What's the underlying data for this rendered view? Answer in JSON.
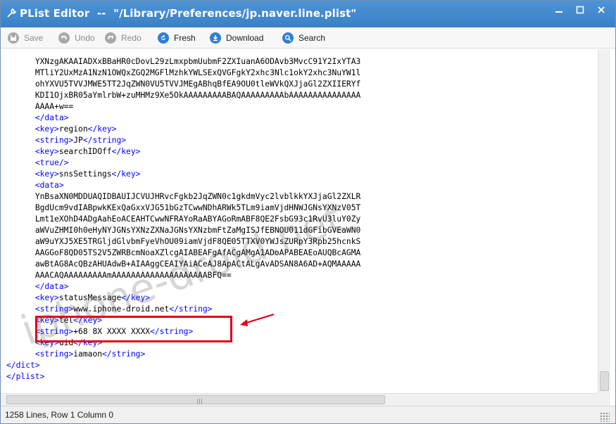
{
  "window": {
    "title": "PList Editor  --  \"/Library/Preferences/jp.naver.line.plist\"",
    "icons": {
      "app": "wrench-icon",
      "minimize": "minimize-icon",
      "maximize": "maximize-icon",
      "close": "close-icon"
    }
  },
  "toolbar": {
    "save": {
      "label": "Save",
      "icon": "save-icon"
    },
    "undo": {
      "label": "Undo",
      "icon": "undo-icon"
    },
    "redo": {
      "label": "Redo",
      "icon": "redo-icon"
    },
    "refresh": {
      "label": "Fresh",
      "icon": "refresh-icon"
    },
    "download": {
      "label": "Download",
      "icon": "download-icon"
    },
    "search": {
      "label": "Search",
      "icon": "search-icon"
    }
  },
  "editor": {
    "lines": [
      {
        "indent": "      ",
        "text": "YXNzgAKAAIADXxBBaHR0cDovL29zLmxpbmUubmF2ZXIuanA6ODAvb3MvcC91Y2IxYTA3"
      },
      {
        "indent": "      ",
        "text": "MTliY2UxMzA1NzN1OWQxZGQ2MGFlMzhkYWLSExQVGFgkY2xhc3Nlc1okY2xhc3NuYW1l"
      },
      {
        "indent": "      ",
        "text": "ohYXVU5TVVJMWE5TT2JqZWN0VU5TVVJMEgABhqBfEA9OU0tleWVkQXJjaGl2ZXIIERYf"
      },
      {
        "indent": "      ",
        "text": "KDI1OjxBR05aYmlrbW+zuMHMz9Xe5OkAAAAAAAAABAQAAAAAAAAAbAAAAAAAAAAAAAAA"
      },
      {
        "indent": "      ",
        "text": "AAAA+w=="
      },
      {
        "indent": "      ",
        "tag_open": "</data>",
        "value": "",
        "tag_close": ""
      },
      {
        "indent": "      ",
        "tag_open": "<key>",
        "value": "region",
        "tag_close": "</key>"
      },
      {
        "indent": "      ",
        "tag_open": "<string>",
        "value": "JP",
        "tag_close": "</string>"
      },
      {
        "indent": "      ",
        "tag_open": "<key>",
        "value": "searchIDOff",
        "tag_close": "</key>"
      },
      {
        "indent": "      ",
        "tag_open": "<true/>",
        "value": "",
        "tag_close": ""
      },
      {
        "indent": "      ",
        "tag_open": "<key>",
        "value": "snsSettings",
        "tag_close": "</key>"
      },
      {
        "indent": "      ",
        "tag_open": "<data>",
        "value": "",
        "tag_close": ""
      },
      {
        "indent": "      ",
        "text": "YnBsaXN0MDDUAQIDBAUIJCVUJHRvcFgkb2JqZWN0c1gkdmVyc2lvblkkYXJjaGl2ZXLR"
      },
      {
        "indent": "      ",
        "text": "BgdUcm9vdIABpwkKExQaGxxVJG51bGzTCwwNDhARWk5TLm9iamVjdHNWJGNsYXNzV05T"
      },
      {
        "indent": "      ",
        "text": "Lmt1eXOhD4ADgAahEoACEAHTCwwNFRAYoRaABYAGoRmABF8QE2FsbG93c1RvU3luY0Zy"
      },
      {
        "indent": "      ",
        "text": "aWVuZHMI0h0eHyNYJGNsYXNzZXNaJGNsYXNzbmFtZaMgISJfEBNOU011dGFibGVEaWN0"
      },
      {
        "indent": "      ",
        "text": "aW9uYXJ5XE5TRGljdGlvbmFyeVhOU09iamVjdF8QE05TTXV0YWJsZURpY3Rpb25hcnkS"
      },
      {
        "indent": "      ",
        "text": "AAGGoF8QD05TS2V5ZWRBcmNoaXZlcgAIABEAFgAfACgAMgA1ADoAPABEAEoAUQBcAGMA"
      },
      {
        "indent": "      ",
        "text": "awBtAG8AcQBzAHUAdwB+AIAAggCEAIYAiACeAJ8ApACtALgAvADSAN8A6AD+AQMAAAAA"
      },
      {
        "indent": "      ",
        "text": "AAACAQAAAAAAAAAmAAAAAAAAAAAAAAAAAAAABFQ=="
      },
      {
        "indent": "      ",
        "tag_open": "</data>",
        "value": "",
        "tag_close": ""
      },
      {
        "indent": "      ",
        "tag_open": "<key>",
        "value": "statusMessage",
        "tag_close": "</key>"
      },
      {
        "indent": "      ",
        "tag_open": "<string>",
        "value": "www.iphone-droid.net",
        "tag_close": "</string>"
      },
      {
        "indent": "      ",
        "tag_open": "<key>",
        "value": "tel",
        "tag_close": "</key>"
      },
      {
        "indent": "      ",
        "tag_open": "<string>",
        "value": "+68 8X XXXX XXXX",
        "tag_close": "</string>"
      },
      {
        "indent": "      ",
        "tag_open": "<key>",
        "value": "uid",
        "tag_close": "</key>"
      },
      {
        "indent": "      ",
        "tag_open": "<string>",
        "value": "iamaon",
        "tag_close": "</string>"
      },
      {
        "indent": "",
        "tag_open": "</dict>",
        "value": "",
        "tag_close": ""
      },
      {
        "indent": "",
        "tag_open": "</plist>",
        "value": "",
        "tag_close": ""
      }
    ]
  },
  "status": {
    "text": "1258 Lines, Row 1 Column 0"
  },
  "watermark": "iphone-droid.net",
  "colors": {
    "titlebar": "#3a80c6",
    "tag": "#0000ff",
    "highlight": "#e0001b",
    "icon_blue": "#2f7fd3"
  }
}
